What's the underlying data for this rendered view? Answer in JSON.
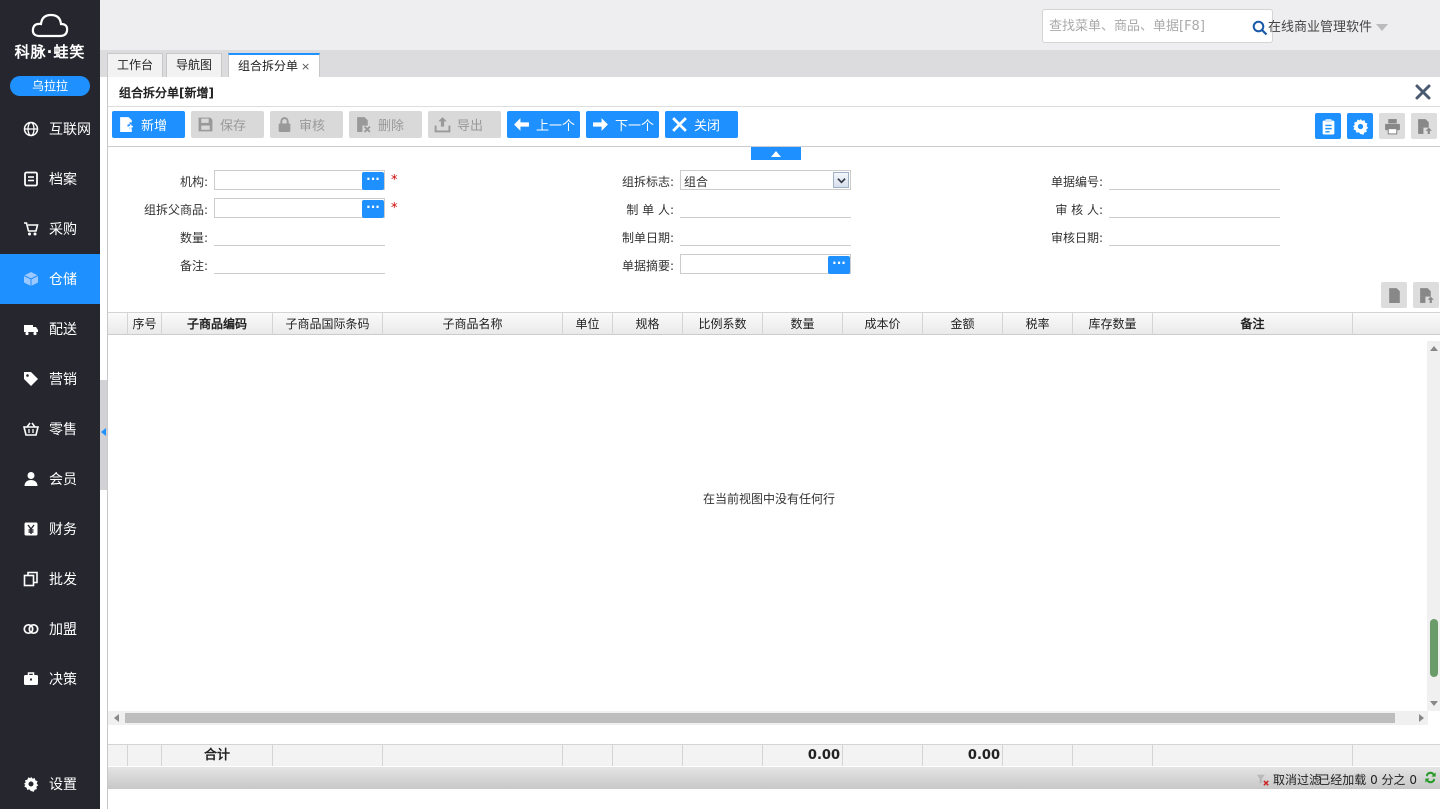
{
  "sidebar": {
    "brand": "科脉·蛙笑",
    "user": "乌拉拉",
    "items": [
      {
        "label": "互联网",
        "icon": "globe-icon"
      },
      {
        "label": "档案",
        "icon": "archive-icon"
      },
      {
        "label": "采购",
        "icon": "cart-icon"
      },
      {
        "label": "仓储",
        "icon": "box-icon",
        "active": true
      },
      {
        "label": "配送",
        "icon": "truck-icon"
      },
      {
        "label": "营销",
        "icon": "tag-icon"
      },
      {
        "label": "零售",
        "icon": "basket-icon"
      },
      {
        "label": "会员",
        "icon": "user-icon"
      },
      {
        "label": "财务",
        "icon": "yen-icon"
      },
      {
        "label": "批发",
        "icon": "copy-icon"
      },
      {
        "label": "加盟",
        "icon": "rings-icon"
      },
      {
        "label": "决策",
        "icon": "briefcase-icon"
      }
    ],
    "settings": "设置"
  },
  "topbar": {
    "search_placeholder": "查找菜单、商品、单据[F8]",
    "software_name": "在线商业管理软件"
  },
  "tabs": [
    {
      "label": "工作台"
    },
    {
      "label": "导航图"
    },
    {
      "label": "组合拆分单",
      "active": true,
      "close": "×"
    }
  ],
  "window": {
    "title": "组合拆分单[新增]"
  },
  "toolbar": {
    "new": "新增",
    "save": "保存",
    "audit": "审核",
    "delete": "删除",
    "export": "导出",
    "prev": "上一个",
    "next": "下一个",
    "close": "关闭"
  },
  "form": {
    "org_label": "机构:",
    "parent_label": "组拆父商品:",
    "qty_label": "数量:",
    "remark_label": "备注:",
    "flag_label": "组拆标志:",
    "flag_value": "组合",
    "maker_label": "制 单 人:",
    "make_date_label": "制单日期:",
    "summary_label": "单据摘要:",
    "doc_no_label": "单据编号:",
    "auditor_label": "审 核 人:",
    "audit_date_label": "审核日期:",
    "required_mark": "*",
    "dots": "···"
  },
  "grid": {
    "columns": [
      "序号",
      "子商品编码",
      "子商品国际条码",
      "子商品名称",
      "单位",
      "规格",
      "比例系数",
      "数量",
      "成本价",
      "金额",
      "税率",
      "库存数量",
      "备注"
    ],
    "empty_message": "在当前视图中没有任何行",
    "total_label": "合计",
    "total_qty": "0.00",
    "total_amount": "0.00"
  },
  "status": {
    "clear_filter": "取消过滤",
    "loaded": "已经加载 0 分之 0"
  },
  "colors": {
    "accent": "#1e90ff",
    "sidebar_bg": "#26262f"
  }
}
